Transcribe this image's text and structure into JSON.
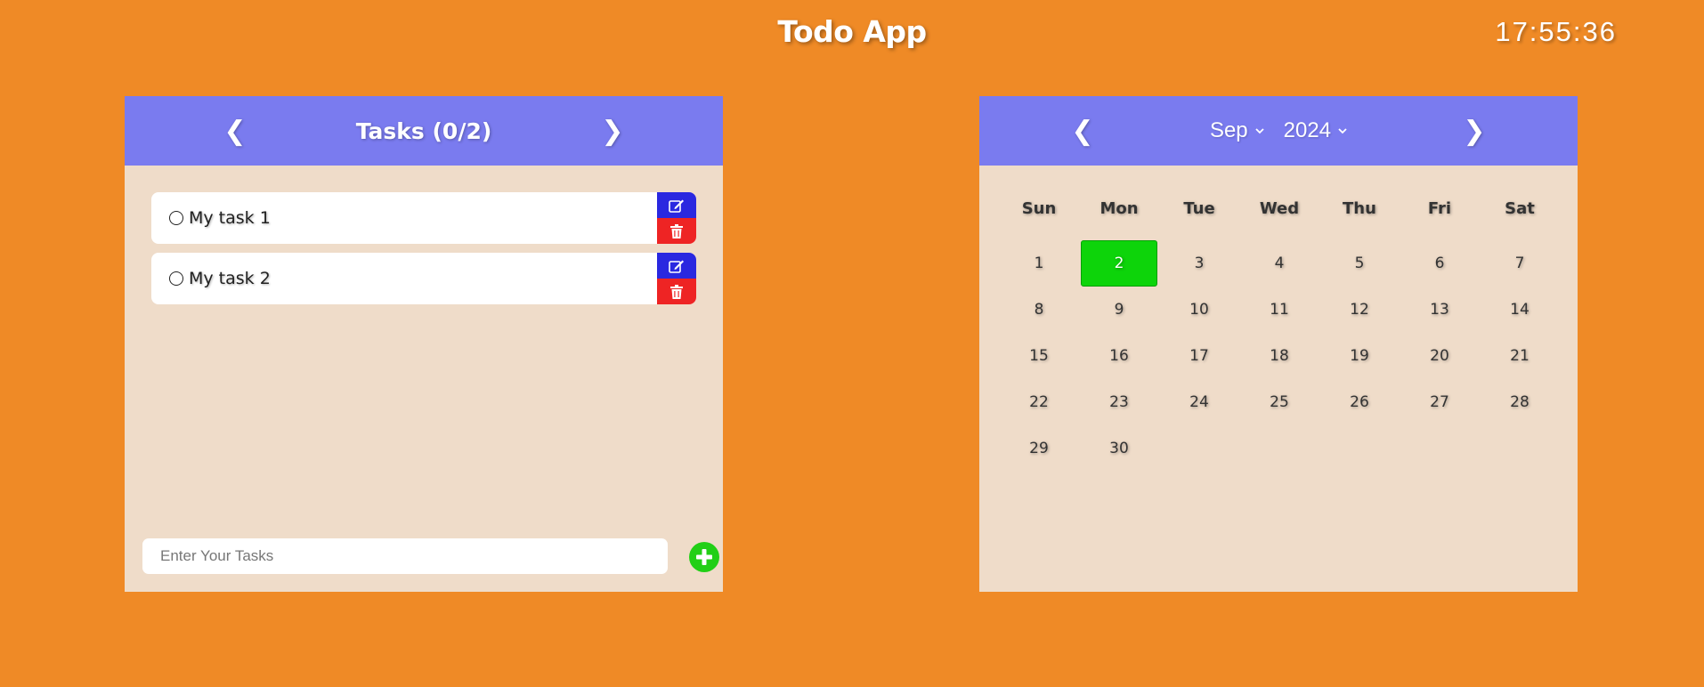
{
  "app": {
    "title": "Todo App",
    "clock": "17:55:36"
  },
  "tasks_panel": {
    "title": "Tasks (0/2)",
    "prev_icon": "❮",
    "next_icon": "❯",
    "items": [
      {
        "text": "My task 1",
        "done": false
      },
      {
        "text": "My task 2",
        "done": false
      }
    ],
    "input_placeholder": "Enter Your Tasks",
    "icons": {
      "edit": "edit-icon",
      "delete": "trash-icon",
      "add": "plus-icon",
      "check": "circle-icon"
    }
  },
  "calendar": {
    "prev_icon": "❮",
    "next_icon": "❯",
    "month": "Sep",
    "year": "2024",
    "weekdays": [
      "Sun",
      "Mon",
      "Tue",
      "Wed",
      "Thu",
      "Fri",
      "Sat"
    ],
    "days": [
      "1",
      "2",
      "3",
      "4",
      "5",
      "6",
      "7",
      "8",
      "9",
      "10",
      "11",
      "12",
      "13",
      "14",
      "15",
      "16",
      "17",
      "18",
      "19",
      "20",
      "21",
      "22",
      "23",
      "24",
      "25",
      "26",
      "27",
      "28",
      "29",
      "30"
    ],
    "selected_day": "2"
  },
  "colors": {
    "background": "#ef8a26",
    "header": "#7a7bef",
    "panel": "#efdcc9",
    "today": "#0dd40a",
    "edit": "#2a28e0",
    "delete": "#ee2424",
    "add": "#22cf16"
  }
}
